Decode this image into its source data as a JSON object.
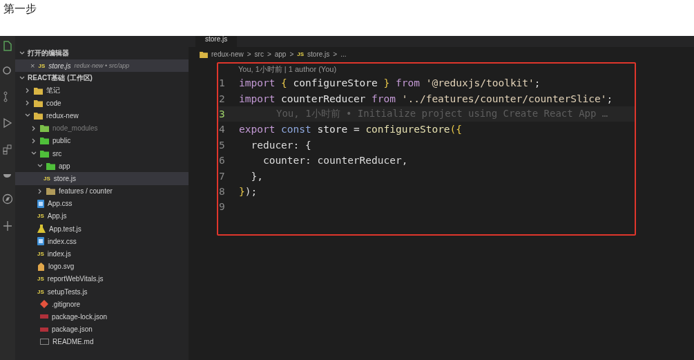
{
  "heading": "第一步",
  "editor_tab": {
    "label": "store.js"
  },
  "explorer": {
    "open_editors": {
      "title": "打开的编辑器",
      "expanded": true,
      "items": [
        {
          "name": "store.js",
          "path": "redux-new • src/app",
          "close": "×",
          "badge": "JS"
        }
      ]
    },
    "workspace": {
      "title": "REACT基础 (工作区)",
      "expanded": true,
      "tree": [
        {
          "name": "笔记",
          "kind": "folder",
          "color": "#d9b544",
          "expanded": false,
          "selected": false,
          "dimmed": false
        },
        {
          "name": "code",
          "kind": "folder",
          "color": "#d9b544",
          "expanded": false,
          "selected": false,
          "dimmed": false
        },
        {
          "name": "redux-new",
          "kind": "folder",
          "color": "#d9b544",
          "expanded": true,
          "selected": false,
          "dimmed": false,
          "children": [
            {
              "name": "node_modules",
              "kind": "folder",
              "color": "#7cc04a",
              "expanded": false,
              "selected": false,
              "dimmed": true
            },
            {
              "name": "public",
              "kind": "folder",
              "color": "#4fbf3a",
              "expanded": false,
              "selected": false,
              "dimmed": false
            },
            {
              "name": "src",
              "kind": "folder",
              "color": "#4fbf3a",
              "expanded": true,
              "selected": false,
              "dimmed": false,
              "children": [
                {
                  "name": "app",
                  "kind": "folder",
                  "color": "#4fbf3a",
                  "expanded": true,
                  "selected": false,
                  "dimmed": false,
                  "children": [
                    {
                      "name": "store.js",
                      "kind": "js",
                      "badge": "JS",
                      "selected": true,
                      "dimmed": false
                    }
                  ]
                },
                {
                  "name": "features / counter",
                  "kind": "folder",
                  "color": "#b09a5a",
                  "expanded": false,
                  "selected": false,
                  "dimmed": false
                },
                {
                  "name": "App.css",
                  "kind": "css",
                  "selected": false,
                  "dimmed": false
                },
                {
                  "name": "App.js",
                  "kind": "js",
                  "badge": "JS",
                  "selected": false,
                  "dimmed": false
                },
                {
                  "name": "App.test.js",
                  "kind": "test",
                  "selected": false,
                  "dimmed": false
                },
                {
                  "name": "index.css",
                  "kind": "css",
                  "selected": false,
                  "dimmed": false
                },
                {
                  "name": "index.js",
                  "kind": "js",
                  "badge": "JS",
                  "selected": false,
                  "dimmed": false
                },
                {
                  "name": "logo.svg",
                  "kind": "svg",
                  "selected": false,
                  "dimmed": false
                },
                {
                  "name": "reportWebVitals.js",
                  "kind": "js",
                  "badge": "JS",
                  "selected": false,
                  "dimmed": false
                },
                {
                  "name": "setupTests.js",
                  "kind": "js",
                  "badge": "JS",
                  "selected": false,
                  "dimmed": false
                }
              ]
            },
            {
              "name": ".gitignore",
              "kind": "git",
              "selected": false,
              "dimmed": false
            },
            {
              "name": "package-lock.json",
              "kind": "json",
              "selected": false,
              "dimmed": false
            },
            {
              "name": "package.json",
              "kind": "json",
              "selected": false,
              "dimmed": false
            },
            {
              "name": "README.md",
              "kind": "md",
              "selected": false,
              "dimmed": false
            }
          ]
        }
      ]
    }
  },
  "breadcrumb": {
    "separator": ">",
    "items": [
      {
        "label": "redux-new",
        "kind": "folder"
      },
      {
        "label": "src",
        "kind": "plain"
      },
      {
        "label": "app",
        "kind": "plain"
      },
      {
        "label": "store.js",
        "kind": "js",
        "badge": "JS"
      },
      {
        "label": "...",
        "kind": "plain"
      }
    ]
  },
  "code": {
    "codelens": "You, 1小时前 | 1 author (You)",
    "lines": [
      {
        "number": "1",
        "current": false,
        "tokens": [
          {
            "kind": "keyword",
            "text": "import"
          },
          {
            "kind": "brace",
            "text": " { "
          },
          {
            "kind": "name",
            "text": "configureStore"
          },
          {
            "kind": "brace",
            "text": " } "
          },
          {
            "kind": "keyword",
            "text": "from"
          },
          {
            "kind": "string",
            "text": " '@reduxjs/toolkit'"
          },
          {
            "kind": "plain",
            "text": ";"
          }
        ]
      },
      {
        "number": "2",
        "current": false,
        "tokens": [
          {
            "kind": "keyword",
            "text": "import"
          },
          {
            "kind": "name",
            "text": " counterReducer "
          },
          {
            "kind": "keyword",
            "text": "from"
          },
          {
            "kind": "string",
            "text": " '../features/counter/counterSlice'"
          },
          {
            "kind": "plain",
            "text": ";"
          }
        ]
      },
      {
        "number": "3",
        "current": true,
        "blame": "You, 1小时前 • Initialize project using Create React App …"
      },
      {
        "number": "4",
        "current": false,
        "tokens": [
          {
            "kind": "keyword",
            "text": "export"
          },
          {
            "kind": "storage",
            "text": " const"
          },
          {
            "kind": "name",
            "text": " store"
          },
          {
            "kind": "plain",
            "text": " = "
          },
          {
            "kind": "func",
            "text": "configureStore"
          },
          {
            "kind": "brace",
            "text": "({"
          }
        ]
      },
      {
        "number": "5",
        "current": false,
        "tokens": [
          {
            "kind": "plain",
            "text": "  reducer: {"
          }
        ]
      },
      {
        "number": "6",
        "current": false,
        "tokens": [
          {
            "kind": "plain",
            "text": "    counter: counterReducer,"
          }
        ]
      },
      {
        "number": "7",
        "current": false,
        "tokens": [
          {
            "kind": "plain",
            "text": "  },"
          }
        ]
      },
      {
        "number": "8",
        "current": false,
        "tokens": [
          {
            "kind": "brace",
            "text": "}"
          },
          {
            "kind": "plain",
            "text": ");"
          }
        ]
      },
      {
        "number": "9",
        "current": false
      }
    ]
  }
}
